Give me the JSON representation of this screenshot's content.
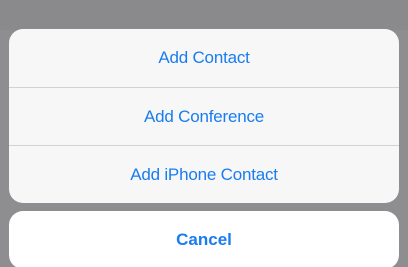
{
  "action_sheet": {
    "items": [
      {
        "label": "Add Contact"
      },
      {
        "label": "Add Conference"
      },
      {
        "label": "Add iPhone Contact"
      }
    ],
    "cancel_label": "Cancel"
  },
  "colors": {
    "accent": "#1a7cf0",
    "overlay": "#8e8e90",
    "sheet_background": "#f7f7f7",
    "cancel_background": "#ffffff"
  }
}
